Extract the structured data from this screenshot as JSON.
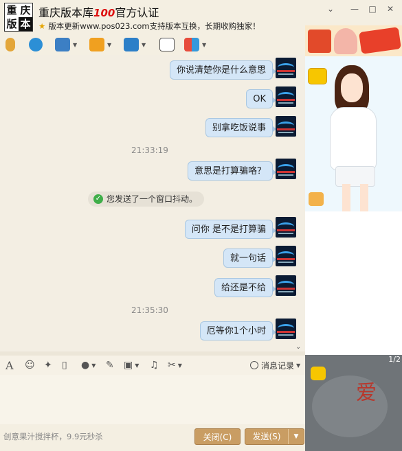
{
  "header": {
    "logo_chars": [
      "重",
      "庆",
      "版",
      "本"
    ],
    "title": "重庆版本库",
    "title_badge": "100",
    "title_suffix": "官方认证",
    "subtitle": "版本更新www.pos023.com支持版本互换，长期收购独家！",
    "window_controls": [
      "minimize-icon",
      "maximize-icon",
      "close-icon"
    ]
  },
  "toolbar": {
    "items": [
      {
        "icon": "microphone-icon",
        "has_dropdown": false
      },
      {
        "icon": "video-camera-icon",
        "has_dropdown": false
      },
      {
        "icon": "remote-assist-icon",
        "has_dropdown": true
      },
      {
        "icon": "file-transfer-icon",
        "has_dropdown": true
      },
      {
        "icon": "screen-share-icon",
        "has_dropdown": true
      },
      {
        "icon": "new-discussion-icon",
        "has_dropdown": false
      },
      {
        "icon": "apps-icon",
        "has_dropdown": true
      }
    ]
  },
  "messages": [
    {
      "type": "sent",
      "text": "你说清楚你是什么意思"
    },
    {
      "type": "sent",
      "text": "OK"
    },
    {
      "type": "sent",
      "text": "别拿吃饭说事"
    },
    {
      "type": "time",
      "text": "21:33:19"
    },
    {
      "type": "sent",
      "text": "意思是打算骗咯？"
    },
    {
      "type": "system",
      "text": "您发送了一个窗口抖动。"
    },
    {
      "type": "sent",
      "text": "问你  是不是打算骗"
    },
    {
      "type": "sent",
      "text": "就一句话"
    },
    {
      "type": "sent",
      "text": "给还是不给"
    },
    {
      "type": "time",
      "text": "21:35:30"
    },
    {
      "type": "sent",
      "text": "厄等你1个小时"
    }
  ],
  "input_toolbar": {
    "items": [
      "font-icon",
      "emoji-icon",
      "magic-icon",
      "shake-window-icon",
      "voice-message-icon",
      "edit-icon",
      "image-icon",
      "music-icon",
      "screenshot-scissors-icon"
    ],
    "history_label": "消息记录"
  },
  "input": {
    "value": ""
  },
  "bottom": {
    "ad_text": "创意果汁搅拌杯，9.9元秒杀",
    "close_label": "关闭(C)",
    "send_label": "发送(S)"
  },
  "sidebar": {
    "photo_text": "爱",
    "photo_pager": "1/2"
  },
  "colors": {
    "bubble": "#d4e6f7",
    "button": "#c99d63",
    "background": "#f3eee3"
  }
}
